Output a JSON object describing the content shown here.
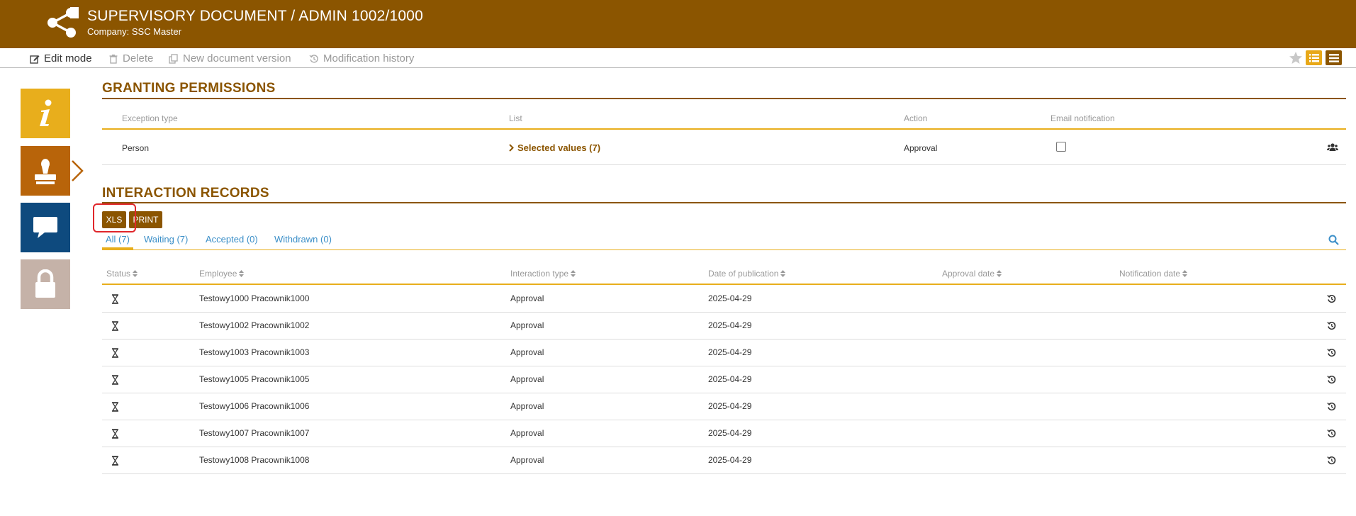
{
  "header": {
    "title": "SUPERVISORY DOCUMENT / ADMIN 1002/1000",
    "subtitle": "Company: SSC Master"
  },
  "toolbar": {
    "edit_mode": "Edit mode",
    "delete": "Delete",
    "new_version": "New document version",
    "history": "Modification history"
  },
  "granting": {
    "title": "GRANTING PERMISSIONS",
    "columns": [
      "Exception type",
      "List",
      "Action",
      "Email notification"
    ],
    "row": {
      "exception_type": "Person",
      "list_link": "Selected values (7)",
      "action": "Approval",
      "email_notification": false
    }
  },
  "interaction": {
    "title": "INTERACTION RECORDS",
    "xls_label": "XLS",
    "print_label": "PRINT",
    "tabs": [
      "All (7)",
      "Waiting (7)",
      "Accepted (0)",
      "Withdrawn (0)"
    ],
    "columns": [
      "Status",
      "Employee",
      "Interaction type",
      "Date of publication",
      "Approval date",
      "Notification date"
    ],
    "rows": [
      {
        "employee": "Testowy1000 Pracownik1000",
        "type": "Approval",
        "published": "2025-04-29",
        "approval_date": "",
        "notification_date": ""
      },
      {
        "employee": "Testowy1002 Pracownik1002",
        "type": "Approval",
        "published": "2025-04-29",
        "approval_date": "",
        "notification_date": ""
      },
      {
        "employee": "Testowy1003 Pracownik1003",
        "type": "Approval",
        "published": "2025-04-29",
        "approval_date": "",
        "notification_date": ""
      },
      {
        "employee": "Testowy1005 Pracownik1005",
        "type": "Approval",
        "published": "2025-04-29",
        "approval_date": "",
        "notification_date": ""
      },
      {
        "employee": "Testowy1006 Pracownik1006",
        "type": "Approval",
        "published": "2025-04-29",
        "approval_date": "",
        "notification_date": ""
      },
      {
        "employee": "Testowy1007 Pracownik1007",
        "type": "Approval",
        "published": "2025-04-29",
        "approval_date": "",
        "notification_date": ""
      },
      {
        "employee": "Testowy1008 Pracownik1008",
        "type": "Approval",
        "published": "2025-04-29",
        "approval_date": "",
        "notification_date": ""
      }
    ]
  },
  "colors": {
    "brand": "#8b5500",
    "accent": "#e8ae1c",
    "link": "#3b8fc8"
  },
  "icons": {
    "logo": "share-icon",
    "row_status": "hourglass-icon",
    "row_action": "history-icon"
  }
}
